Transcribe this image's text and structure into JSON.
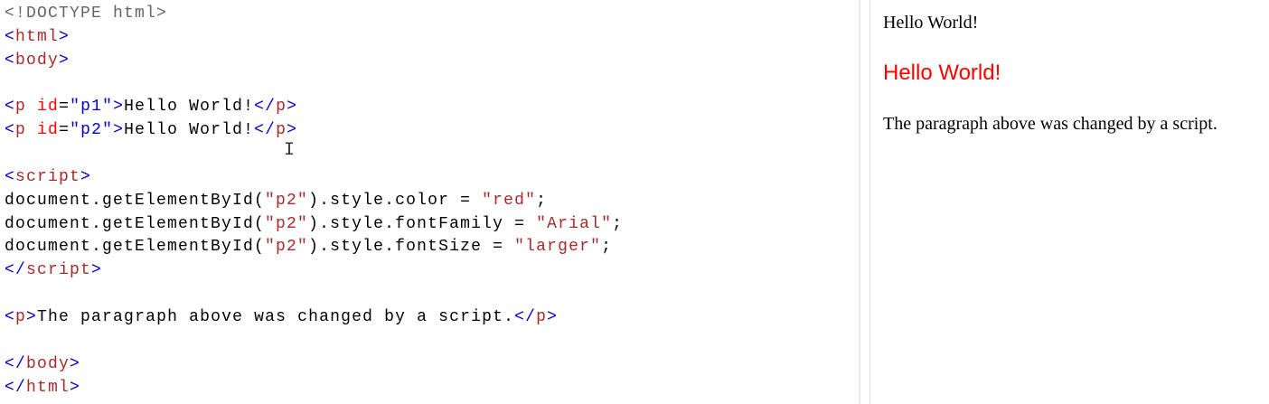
{
  "editor": {
    "lines": [
      [
        {
          "t": "<!DOCTYPE html>",
          "c": "doc"
        }
      ],
      [
        {
          "t": "<",
          "c": "punct"
        },
        {
          "t": "html",
          "c": "tag"
        },
        {
          "t": ">",
          "c": "punct"
        }
      ],
      [
        {
          "t": "<",
          "c": "punct"
        },
        {
          "t": "body",
          "c": "tag"
        },
        {
          "t": ">",
          "c": "punct"
        }
      ],
      [],
      [
        {
          "t": "<",
          "c": "punct"
        },
        {
          "t": "p",
          "c": "tag"
        },
        {
          "t": " ",
          "c": "text"
        },
        {
          "t": "id",
          "c": "attr"
        },
        {
          "t": "=",
          "c": "text"
        },
        {
          "t": "\"p1\"",
          "c": "val"
        },
        {
          "t": ">",
          "c": "punct"
        },
        {
          "t": "Hello World!",
          "c": "text"
        },
        {
          "t": "</",
          "c": "punct"
        },
        {
          "t": "p",
          "c": "tag"
        },
        {
          "t": ">",
          "c": "punct"
        }
      ],
      [
        {
          "t": "<",
          "c": "punct"
        },
        {
          "t": "p",
          "c": "tag"
        },
        {
          "t": " ",
          "c": "text"
        },
        {
          "t": "id",
          "c": "attr"
        },
        {
          "t": "=",
          "c": "text"
        },
        {
          "t": "\"p2\"",
          "c": "val"
        },
        {
          "t": ">",
          "c": "punct"
        },
        {
          "t": "Hello World!",
          "c": "text"
        },
        {
          "t": "</",
          "c": "punct"
        },
        {
          "t": "p",
          "c": "tag"
        },
        {
          "t": ">",
          "c": "punct"
        }
      ],
      [],
      [
        {
          "t": "<",
          "c": "punct"
        },
        {
          "t": "script",
          "c": "tag"
        },
        {
          "t": ">",
          "c": "punct"
        }
      ],
      [
        {
          "t": "document.getElementById(",
          "c": "text"
        },
        {
          "t": "\"p2\"",
          "c": "str"
        },
        {
          "t": ").style.color = ",
          "c": "text"
        },
        {
          "t": "\"red\"",
          "c": "str"
        },
        {
          "t": ";",
          "c": "text"
        }
      ],
      [
        {
          "t": "document.getElementById(",
          "c": "text"
        },
        {
          "t": "\"p2\"",
          "c": "str"
        },
        {
          "t": ").style.fontFamily = ",
          "c": "text"
        },
        {
          "t": "\"Arial\"",
          "c": "str"
        },
        {
          "t": ";",
          "c": "text"
        }
      ],
      [
        {
          "t": "document.getElementById(",
          "c": "text"
        },
        {
          "t": "\"p2\"",
          "c": "str"
        },
        {
          "t": ").style.fontSize = ",
          "c": "text"
        },
        {
          "t": "\"larger\"",
          "c": "str"
        },
        {
          "t": ";",
          "c": "text"
        }
      ],
      [
        {
          "t": "</",
          "c": "punct"
        },
        {
          "t": "script",
          "c": "tag"
        },
        {
          "t": ">",
          "c": "punct"
        }
      ],
      [],
      [
        {
          "t": "<",
          "c": "punct"
        },
        {
          "t": "p",
          "c": "tag"
        },
        {
          "t": ">",
          "c": "punct"
        },
        {
          "t": "The paragraph above was changed by a script.",
          "c": "text"
        },
        {
          "t": "</",
          "c": "punct"
        },
        {
          "t": "p",
          "c": "tag"
        },
        {
          "t": ">",
          "c": "punct"
        }
      ],
      [],
      [
        {
          "t": "</",
          "c": "punct"
        },
        {
          "t": "body",
          "c": "tag"
        },
        {
          "t": ">",
          "c": "punct"
        }
      ],
      [
        {
          "t": "</",
          "c": "punct"
        },
        {
          "t": "html",
          "c": "tag"
        },
        {
          "t": ">",
          "c": "punct"
        }
      ]
    ],
    "cursor_icon": "text-cursor-ibeam"
  },
  "preview": {
    "p1": "Hello World!",
    "p2": "Hello World!",
    "p3": "The paragraph above was changed by a script.",
    "p2_color": "#ff0000"
  },
  "colors": {
    "punct": "#0000cd",
    "tag": "#a52a2a",
    "attr": "#ff0000",
    "value": "#0000cd",
    "string": "#a52a2a",
    "doctype": "#666666"
  }
}
